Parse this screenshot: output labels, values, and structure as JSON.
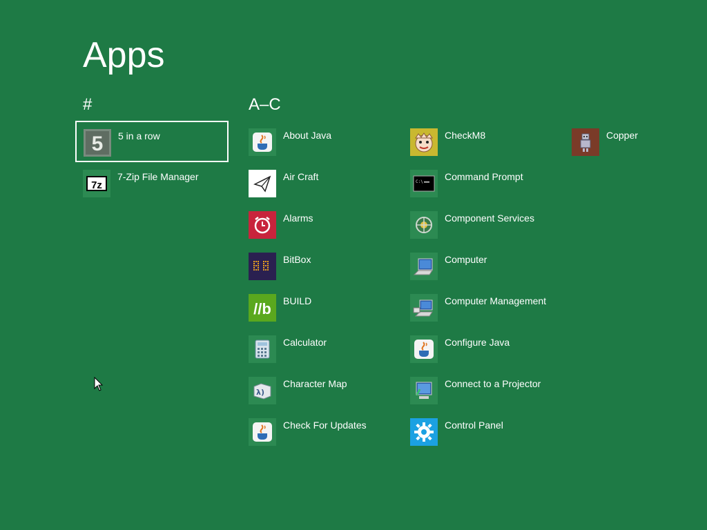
{
  "page": {
    "title": "Apps"
  },
  "groups": {
    "hash": {
      "header": "#"
    },
    "a_c": {
      "header": "A–C"
    }
  },
  "apps": {
    "five_in_a_row": "5 in a row",
    "seven_zip": "7-Zip File Manager",
    "about_java": "About Java",
    "air_craft": "Air Craft",
    "alarms": "Alarms",
    "bitbox": "BitBox",
    "build": "BUILD",
    "calculator": "Calculator",
    "character_map": "Character Map",
    "check_for_updates": "Check For Updates",
    "checkm8": "CheckM8",
    "command_prompt": "Command Prompt",
    "component_services": "Component Services",
    "computer": "Computer",
    "computer_management": "Computer Management",
    "configure_java": "Configure Java",
    "connect_projector": "Connect to a Projector",
    "control_panel": "Control Panel",
    "copper": "Copper"
  },
  "icons": {
    "five_in_a_row": "number-five-icon",
    "seven_zip": "seven-zip-icon",
    "java": "java-cup-icon",
    "air_craft": "paper-plane-icon",
    "alarms": "alarm-clock-icon",
    "bitbox": "bitbox-icon",
    "build": "build-logo-icon",
    "calculator": "calculator-icon",
    "character_map": "character-map-icon",
    "checkm8": "checkm8-icon",
    "command_prompt": "command-prompt-icon",
    "component_services": "component-services-icon",
    "computer": "computer-icon",
    "computer_management": "computer-management-icon",
    "connect_projector": "projector-icon",
    "control_panel": "gear-icon",
    "copper": "copper-robot-icon"
  },
  "colors": {
    "background": "#1e7a45",
    "tile_default": "#2c8a52",
    "alarms": "#c8243c",
    "bitbox": "#2a2050",
    "build": "#5aa81e",
    "control_panel": "#1ba1e2",
    "copper": "#7a3b28"
  }
}
